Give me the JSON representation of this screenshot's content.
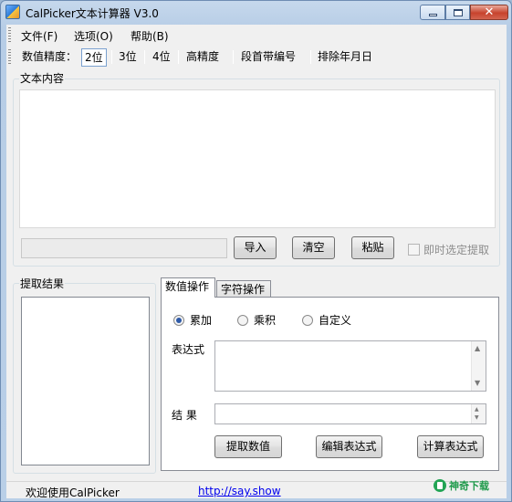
{
  "window": {
    "title": "CalPicker文本计算器 V3.0"
  },
  "menu": [
    {
      "label": "文件(F)"
    },
    {
      "label": "选项(O)"
    },
    {
      "label": "帮助(B)"
    }
  ],
  "toolbar": {
    "precision_label": "数值精度：",
    "items": [
      {
        "label": "2位",
        "selected": true
      },
      {
        "label": "3位"
      },
      {
        "label": "4位"
      },
      {
        "label": "高精度"
      },
      {
        "label": "段首带编号"
      },
      {
        "label": "排除年月日"
      }
    ]
  },
  "text_section": {
    "title": "文本内容",
    "input_value": "",
    "buttons": {
      "import": "导入",
      "clear": "清空",
      "paste": "粘贴"
    },
    "checkbox_label": "即时选定提取",
    "checkbox_checked": false
  },
  "results": {
    "title": "提取结果"
  },
  "tabs": [
    {
      "label": "数值操作",
      "active": true
    },
    {
      "label": "字符操作"
    }
  ],
  "operations": {
    "radios": [
      {
        "label": "累加",
        "checked": true
      },
      {
        "label": "乘积",
        "checked": false
      },
      {
        "label": "自定义",
        "checked": false
      }
    ],
    "expression_label": "表达式",
    "result_label": "结    果",
    "buttons": {
      "extract": "提取数值",
      "edit": "编辑表达式",
      "compute": "计算表达式"
    }
  },
  "status": {
    "text": "欢迎使用CalPicker",
    "link": "http://say.show"
  },
  "watermark": {
    "text": "神奇下载"
  },
  "colors": {
    "selected_tool_border": "#7aa0cf",
    "link": "#0000ee",
    "radio_dot": "#2e5aa8"
  }
}
